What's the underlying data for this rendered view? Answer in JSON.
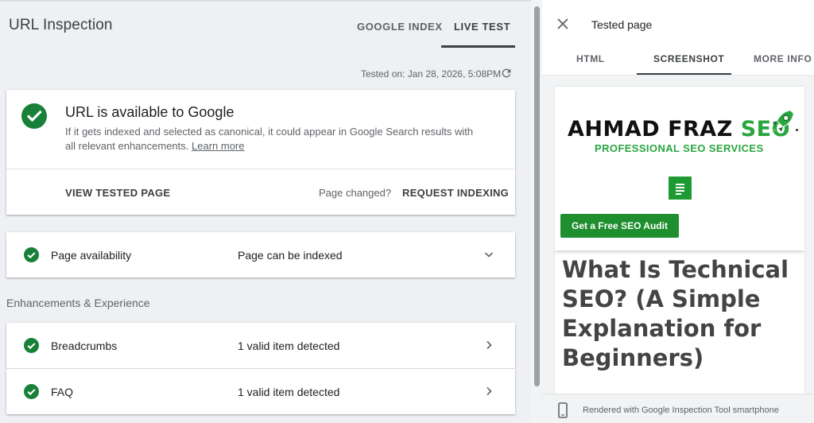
{
  "header": {
    "title": "URL Inspection",
    "tabs": [
      {
        "label": "GOOGLE INDEX",
        "active": false
      },
      {
        "label": "LIVE TEST",
        "active": true
      }
    ],
    "tested_on": "Tested on: Jan 28, 2026, 5:08PM"
  },
  "status_card": {
    "title": "URL is available to Google",
    "description": "If it gets indexed and selected as canonical, it could appear in Google Search results with all relevant enhancements.",
    "learn_more": "Learn more",
    "view_tested_page": "VIEW TESTED PAGE",
    "page_changed": "Page changed?",
    "request_indexing": "REQUEST INDEXING"
  },
  "availability": {
    "name": "Page availability",
    "value": "Page can be indexed"
  },
  "enhancements": {
    "section_label": "Enhancements & Experience",
    "items": [
      {
        "name": "Breadcrumbs",
        "value": "1 valid item detected"
      },
      {
        "name": "FAQ",
        "value": "1 valid item detected"
      }
    ]
  },
  "panel": {
    "title": "Tested page",
    "tabs": [
      {
        "label": "HTML",
        "active": false
      },
      {
        "label": "SCREENSHOT",
        "active": true
      },
      {
        "label": "MORE INFO",
        "active": false
      }
    ],
    "footer": "Rendered with Google Inspection Tool smartphone"
  },
  "screenshot": {
    "logo_main": "AHMAD FRAZ ",
    "logo_seo": "SEO",
    "logo_sub": "PROFESSIONAL SEO SERVICES",
    "cta": "Get a Free SEO Audit",
    "article_title": "What Is Technical SEO? (A Simple Explanation for Beginners)"
  },
  "colors": {
    "success_green": "#188038",
    "brand_green": "#2aa640",
    "text_primary": "#202124",
    "text_secondary": "#5f6368"
  },
  "icons": {
    "success": "check-circle-icon",
    "refresh": "refresh-icon",
    "expand": "chevron-down-icon",
    "open": "chevron-right-icon",
    "close": "close-icon",
    "device": "smartphone-icon"
  }
}
